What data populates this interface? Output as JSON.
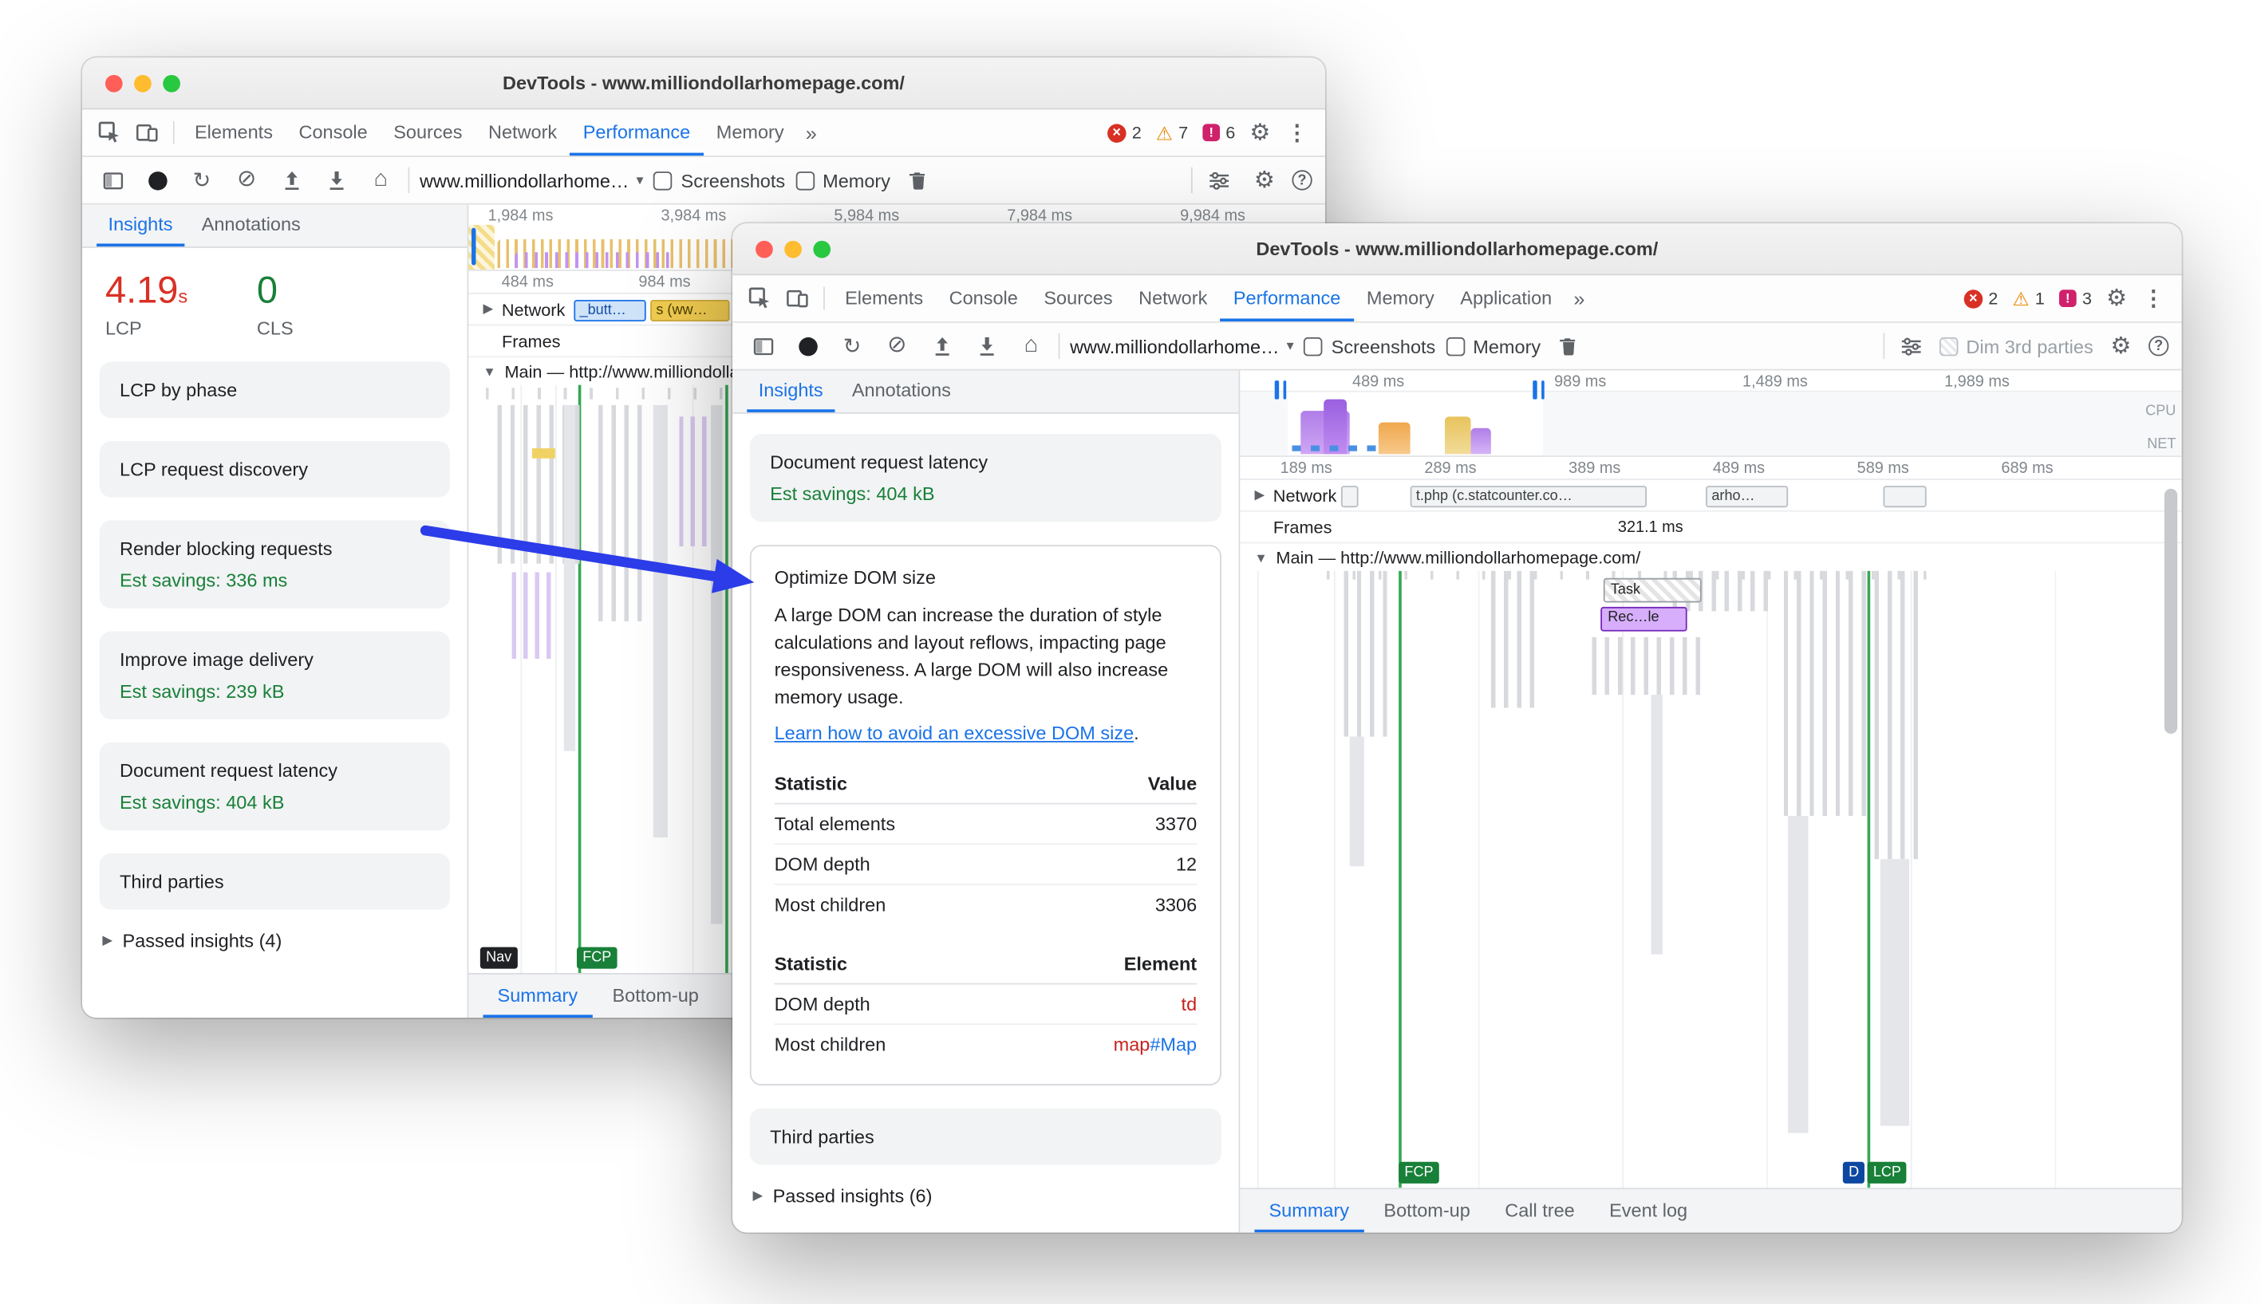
{
  "colors": {
    "accent": "#1a73e8",
    "metric_bad": "#d93025",
    "metric_good": "#188038",
    "arrow": "#2b3ce8"
  },
  "arrow": {
    "color": "#2b3ce8"
  },
  "window1": {
    "title": "DevTools - www.milliondollarhomepage.com/",
    "tabs": [
      "Elements",
      "Console",
      "Sources",
      "Network",
      "Performance",
      "Memory"
    ],
    "more_tabs": "»",
    "badges": {
      "errors": "2",
      "warnings": "7",
      "issues": "6"
    },
    "toolbar": {
      "url": "www.milliondollarhome…",
      "screenshots_label": "Screenshots",
      "memory_label": "Memory"
    },
    "sidebar": {
      "tab_insights": "Insights",
      "tab_annotations": "Annotations",
      "lcp": {
        "value": "4.19",
        "unit": "s",
        "label": "LCP"
      },
      "cls": {
        "value": "0",
        "label": "CLS"
      },
      "insights": [
        {
          "title": "LCP by phase"
        },
        {
          "title": "LCP request discovery"
        },
        {
          "title": "Render blocking requests",
          "savings": "Est savings: 336 ms"
        },
        {
          "title": "Improve image delivery",
          "savings": "Est savings: 239 kB"
        },
        {
          "title": "Document request latency",
          "savings": "Est savings: 404 kB"
        },
        {
          "title": "Third parties"
        }
      ],
      "passed": "Passed insights (4)"
    },
    "timeline": {
      "overview_labels": [
        "1,984 ms",
        "3,984 ms",
        "5,984 ms",
        "7,984 ms",
        "9,984 ms"
      ],
      "ruler_labels": [
        "484 ms",
        "984 ms"
      ],
      "network_label": "Network",
      "network_chips": [
        "_butt…",
        "s (ww…"
      ],
      "frames_label": "Frames",
      "main_label": "Main — http://www.milliondollarhomepage.com/",
      "nav_marker": "Nav",
      "fcp_marker": "FCP",
      "bottom_tabs": [
        "Summary",
        "Bottom-up"
      ]
    }
  },
  "window2": {
    "title": "DevTools - www.milliondollarhomepage.com/",
    "tabs": [
      "Elements",
      "Console",
      "Sources",
      "Network",
      "Performance",
      "Memory",
      "Application"
    ],
    "more_tabs": "»",
    "badges": {
      "errors": "2",
      "warnings": "1",
      "issues": "3"
    },
    "toolbar": {
      "url": "www.milliondollarhome…",
      "screenshots_label": "Screenshots",
      "memory_label": "Memory",
      "dim_label": "Dim 3rd parties"
    },
    "sidebar": {
      "tab_insights": "Insights",
      "tab_annotations": "Annotations",
      "doc_latency": {
        "title": "Document request latency",
        "savings": "Est savings: 404 kB"
      },
      "optimize_dom": {
        "title": "Optimize DOM size",
        "description": "A large DOM can increase the duration of style calculations and layout reflows, impacting page responsiveness. A large DOM will also increase memory usage.",
        "link_text": "Learn how to avoid an excessive DOM size",
        "link_suffix": ".",
        "stats_value": {
          "col_stat": "Statistic",
          "col_value": "Value",
          "rows": [
            {
              "label": "Total elements",
              "value": "3370"
            },
            {
              "label": "DOM depth",
              "value": "12"
            },
            {
              "label": "Most children",
              "value": "3306"
            }
          ]
        },
        "stats_element": {
          "col_stat": "Statistic",
          "col_value": "Element",
          "row_depth": {
            "label": "DOM depth",
            "value": "td"
          },
          "row_children": {
            "label": "Most children",
            "value_tag": "map",
            "value_id": "#Map"
          }
        }
      },
      "third_parties": {
        "title": "Third parties"
      },
      "passed": "Passed insights (6)"
    },
    "timeline": {
      "overview_labels": [
        "489 ms",
        "989 ms",
        "1,489 ms",
        "1,989 ms"
      ],
      "lane_cpu": "CPU",
      "lane_net": "NET",
      "ruler_labels": [
        "189 ms",
        "289 ms",
        "389 ms",
        "489 ms",
        "589 ms",
        "689 ms"
      ],
      "network_label": "Network",
      "network_chips": [
        "t.php (c.statcounter.co…",
        "arho…"
      ],
      "frames_label": "Frames",
      "frame_time": "321.1 ms",
      "main_label": "Main — http://www.milliondollarhomepage.com/",
      "task_chip": "Task",
      "recalc_chip": "Rec…le",
      "fcp_marker": "FCP",
      "dcl_marker": "D",
      "lcp_marker": "LCP",
      "bottom_tabs": [
        "Summary",
        "Bottom-up",
        "Call tree",
        "Event log"
      ]
    }
  }
}
